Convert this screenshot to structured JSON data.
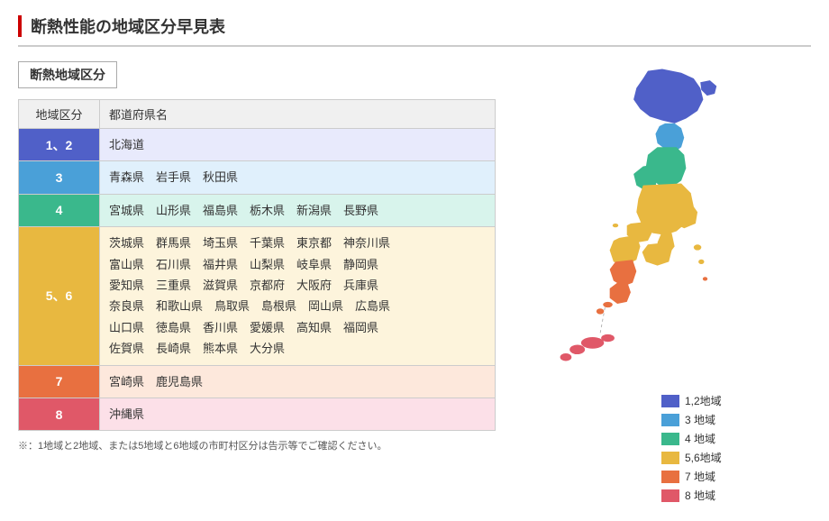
{
  "page": {
    "main_title": "断熱性能の地域区分早見表",
    "section_title": "断熱地域区分",
    "table": {
      "col_zone": "地域区分",
      "col_pref": "都道府県名",
      "rows": [
        {
          "zone": "1、2",
          "zone_class": "zone-12",
          "bg_class": "zone-12-bg",
          "prefs": "北海道"
        },
        {
          "zone": "3",
          "zone_class": "zone-3",
          "bg_class": "zone-3-bg",
          "prefs": "青森県　岩手県　秋田県"
        },
        {
          "zone": "4",
          "zone_class": "zone-4",
          "bg_class": "zone-4-bg",
          "prefs": "宮城県　山形県　福島県　栃木県　新潟県　長野県"
        },
        {
          "zone": "5、6",
          "zone_class": "zone-56",
          "bg_class": "zone-56-bg",
          "prefs_lines": [
            "茨城県　群馬県　埼玉県　千葉県　東京都　神奈川県",
            "富山県　石川県　福井県　山梨県　岐阜県　静岡県",
            "愛知県　三重県　滋賀県　京都府　大阪府　兵庫県",
            "奈良県　和歌山県　鳥取県　島根県　岡山県　広島県",
            "山口県　徳島県　香川県　愛媛県　高知県　福岡県",
            "佐賀県　長崎県　熊本県　大分県"
          ]
        },
        {
          "zone": "7",
          "zone_class": "zone-7",
          "bg_class": "zone-7-bg",
          "prefs": "宮崎県　鹿児島県"
        },
        {
          "zone": "8",
          "zone_class": "zone-8",
          "bg_class": "zone-8-bg",
          "prefs": "沖縄県"
        }
      ]
    },
    "footnote": "※：1地域と2地域、または5地域と6地域の市町村区分は告示等でご確認ください。",
    "legend": [
      {
        "label": "1,2地域",
        "color": "#5060c8"
      },
      {
        "label": "3 地域",
        "color": "#4aa0d8"
      },
      {
        "label": "4 地域",
        "color": "#3ab88c"
      },
      {
        "label": "5,6地域",
        "color": "#e8b840"
      },
      {
        "label": "7 地域",
        "color": "#e87040"
      },
      {
        "label": "8 地域",
        "color": "#e05868"
      }
    ]
  }
}
